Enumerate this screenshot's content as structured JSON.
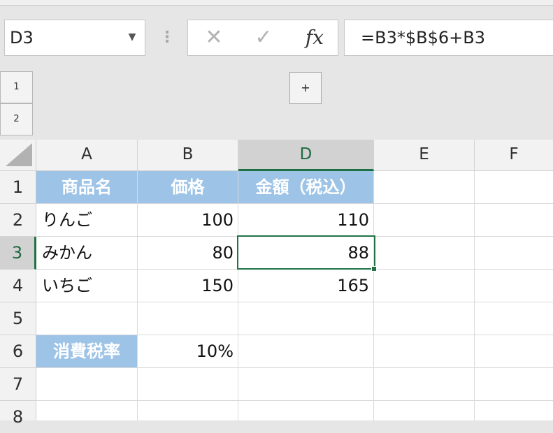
{
  "name_box": {
    "value": "D3"
  },
  "formula_bar": {
    "cancel_glyph": "✕",
    "enter_glyph": "✓",
    "fx_label": "fx",
    "formula": "=B3*$B$6+B3"
  },
  "outline": {
    "levels": [
      "1",
      "2"
    ],
    "expand_label": "+"
  },
  "columns": [
    "A",
    "B",
    "D",
    "E",
    "F"
  ],
  "active_column": "D",
  "rows": [
    "1",
    "2",
    "3",
    "4",
    "5",
    "6",
    "7",
    "8"
  ],
  "active_row": "3",
  "cells": {
    "A1": "商品名",
    "B1": "価格",
    "D1": "金額（税込）",
    "A2": "りんご",
    "B2": "100",
    "D2": "110",
    "A3": "みかん",
    "B3": "80",
    "D3": "88",
    "A4": "いちご",
    "B4": "150",
    "D4": "165",
    "A6": "消費税率",
    "B6": "10%"
  },
  "colors": {
    "header_fill": "#9dc3e6",
    "selection": "#217346",
    "active_header_text": "#1e6b41"
  }
}
